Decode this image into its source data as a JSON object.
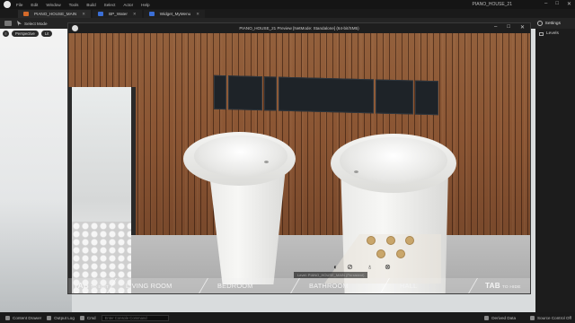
{
  "menubar": {
    "items": [
      "File",
      "Edit",
      "Window",
      "Tools",
      "Build",
      "Select",
      "Actor",
      "Help"
    ],
    "project_name": "PIANO_HOUSE_21",
    "minimize": "–",
    "maximize": "□",
    "close": "✕"
  },
  "tabs": [
    {
      "label": "PIANO_HOUSE_MAIN",
      "close": "✕"
    },
    {
      "label": "BP_Water",
      "close": "✕"
    },
    {
      "label": "Widget_MyMenu",
      "close": "✕"
    }
  ],
  "toolbar": {
    "select_mode": "Select Mode",
    "settings": "Settings"
  },
  "viewport": {
    "perspective": "Perspective",
    "lit": "Lit"
  },
  "outliner": {
    "levels": "Levels"
  },
  "preview": {
    "title": "PIANO_HOUSE_21 Preview [NetMode: Standalone] (64-bit/SM5)",
    "minimize": "–",
    "maximize": "□",
    "close": "✕"
  },
  "nav": {
    "tab_key": "TAB",
    "tab_edit": "TO EDIT",
    "rooms": [
      "LIVING ROOM",
      "BEDROOM",
      "BATHROOM",
      "HALL"
    ],
    "tab_hide_key": "TAB",
    "tab_hide": "TO HIDE"
  },
  "lights": {
    "toggle_count": 4,
    "icon_names": [
      "light-off-icon",
      "light-on-icon",
      "bulb-icon",
      "bulb-off-icon"
    ]
  },
  "sublevel": "Level: PIANO_HOUSE_MAIN (Persistent)",
  "statusbar": {
    "content_drawer": "Content Drawer",
    "output_log": "Output Log",
    "cmd": "Cmd",
    "cmd_placeholder": "Enter Console Command",
    "derived_data": "Derived Data",
    "source_control": "Source Control Off"
  }
}
